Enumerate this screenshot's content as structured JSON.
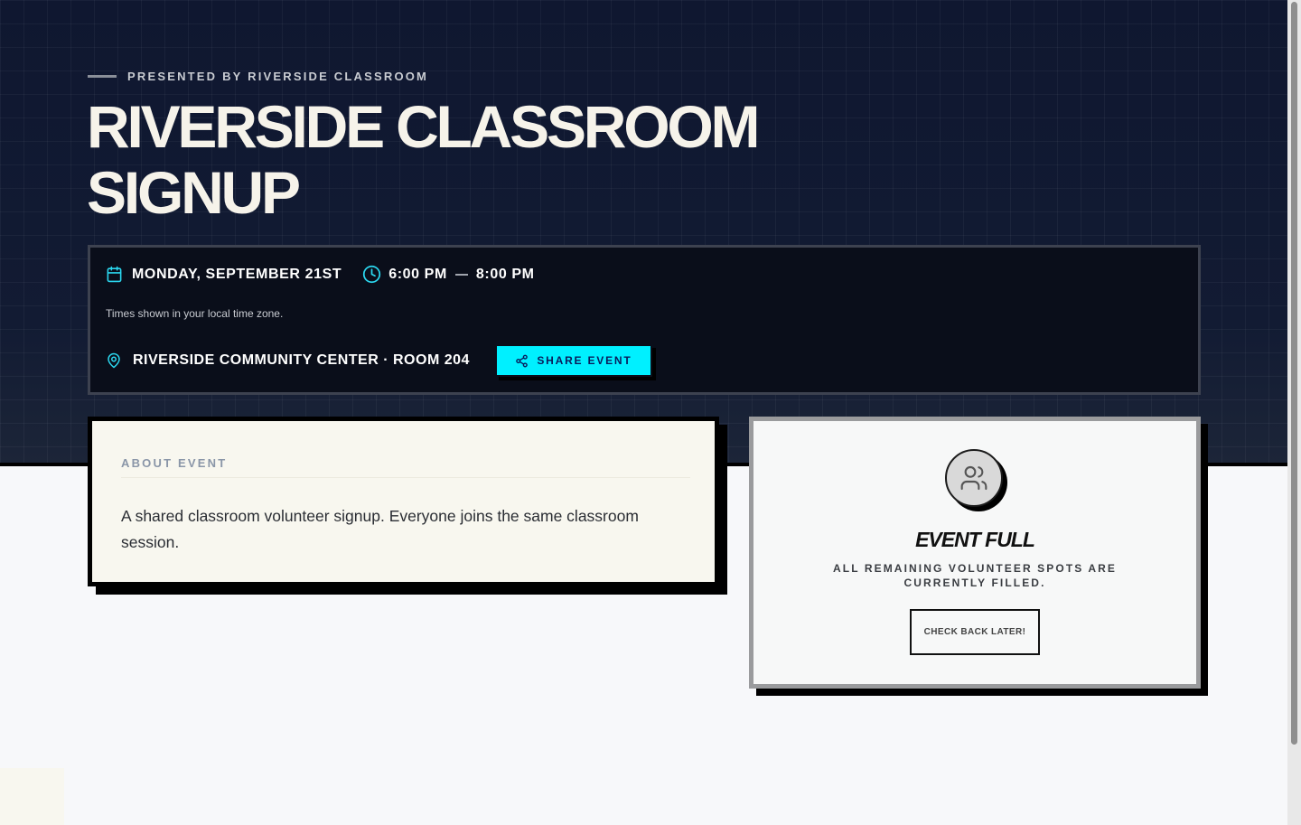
{
  "hero": {
    "presented_by": "PRESENTED BY RIVERSIDE CLASSROOM",
    "title": "RIVERSIDE CLASSROOM SIGNUP"
  },
  "event_info": {
    "date": "MONDAY, SEPTEMBER 21ST",
    "start_time": "6:00 PM",
    "end_time": "8:00 PM",
    "timezone_note": "Times shown in your local time zone.",
    "location": "RIVERSIDE COMMUNITY CENTER · ROOM 204",
    "share_label": "SHARE EVENT"
  },
  "about": {
    "label": "ABOUT EVENT",
    "description": "A shared classroom volunteer signup. Everyone joins the same classroom session."
  },
  "status": {
    "title": "EVENT FULL",
    "subtitle": "ALL REMAINING VOLUNTEER SPOTS ARE CURRENTLY FILLED.",
    "button_label": "CHECK BACK LATER!"
  },
  "colors": {
    "hero_bg": "#111a30",
    "accent_cyan": "#00f0ff",
    "card_cream": "#f8f7ef"
  },
  "icons": {
    "date": "calendar-icon",
    "time": "clock-icon",
    "location": "map-pin-icon",
    "share": "share-icon",
    "status": "users-icon"
  }
}
